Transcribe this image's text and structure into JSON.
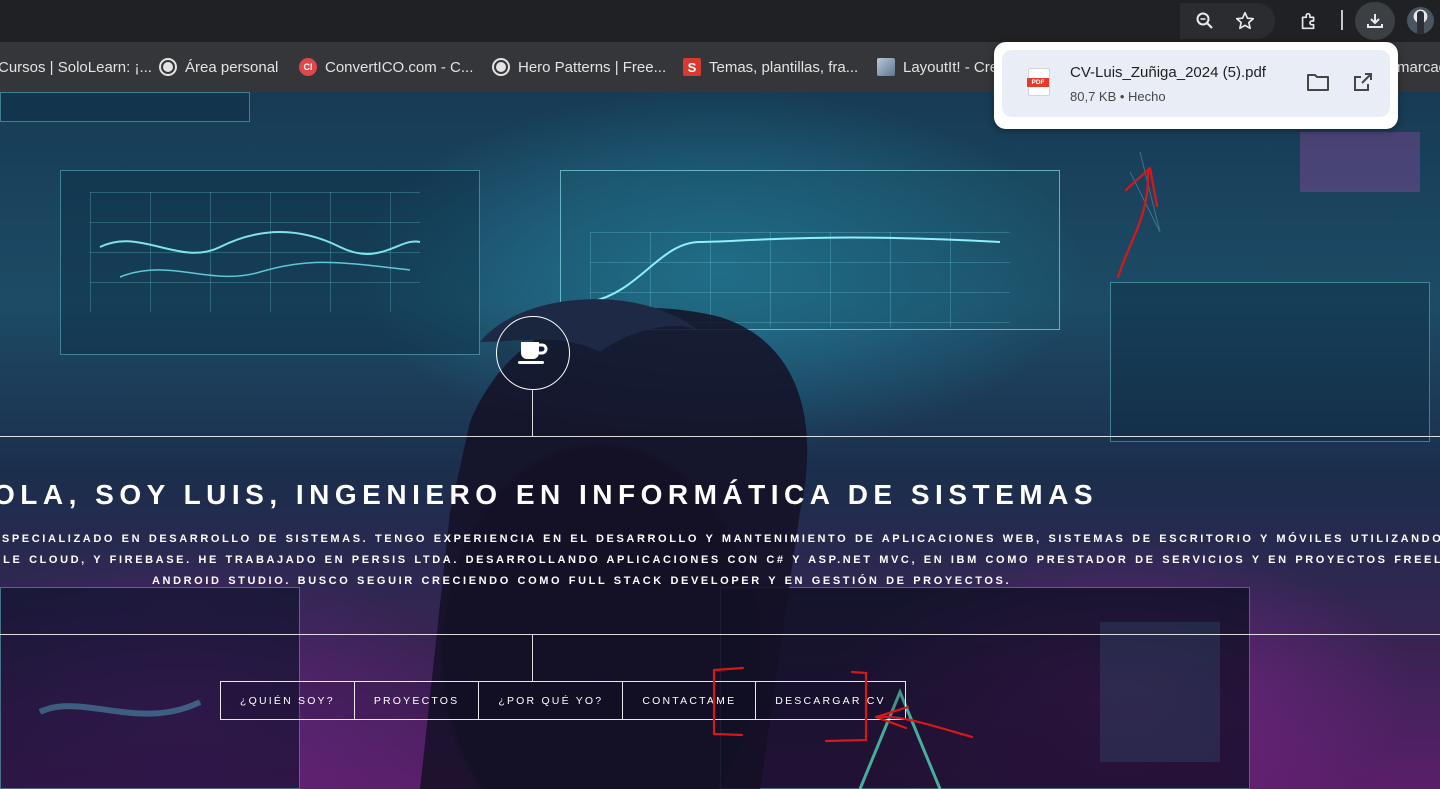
{
  "toolbar": {
    "icons": [
      "zoom-icon",
      "star-icon",
      "extensions-icon",
      "download-icon",
      "profile-avatar"
    ]
  },
  "bookmarks": [
    {
      "label": "Cursos | SoloLearn: ¡...",
      "icon": "sololearn-icon"
    },
    {
      "label": "Área personal",
      "icon": "globe-icon"
    },
    {
      "label": "ConvertICO.com - C...",
      "icon": "converticon-icon",
      "icon_text": "CI"
    },
    {
      "label": "Hero Patterns | Free...",
      "icon": "globe-icon"
    },
    {
      "label": "Temas, plantillas, fra...",
      "icon": "s-icon",
      "icon_text": "S"
    },
    {
      "label": "LayoutIt! - Cre",
      "icon": "cube-icon"
    },
    {
      "label": "marcad",
      "icon": ""
    }
  ],
  "download": {
    "filename": "CV-Luis_Zuñiga_2024 (5).pdf",
    "status": "80,7 KB • Hecho",
    "file_badge": "PDF"
  },
  "hero": {
    "headline": "OLA, SOY LUIS, INGENIERO EN INFORMÁTICA DE SISTEMAS",
    "intro_lines": [
      "ESPECIALIZADO EN DESARROLLO DE SISTEMAS. TENGO EXPERIENCIA EN EL DESARROLLO Y MANTENIMIENTO DE APLICACIONES WEB, SISTEMAS DE ESCRITORIO Y MÓVILES UTILIZANDO TECNOLOGÍAS COMO C#,",
      "GLE CLOUD, Y FIREBASE. HE TRABAJADO EN PERSIS LTDA. DESARROLLANDO APLICACIONES CON C# Y ASP.NET MVC, EN IBM COMO PRESTADOR DE SERVICIOS Y EN PROYECTOS FREELANCE CON GOOGLE CLOUD Y",
      "ANDROID STUDIO. BUSCO SEGUIR CRECIENDO COMO FULL STACK DEVELOPER Y EN GESTIÓN DE PROYECTOS."
    ]
  },
  "nav": {
    "about": "¿QUIÉN SOY?",
    "projects": "PROYECTOS",
    "why_me": "¿POR QUÉ YO?",
    "contact": "CONTACTAME",
    "download_cv": "DESCARGAR CV"
  },
  "colors": {
    "annotation": "#d81818",
    "chrome_bg": "#202124",
    "bookmarks_bg": "#35363a"
  }
}
